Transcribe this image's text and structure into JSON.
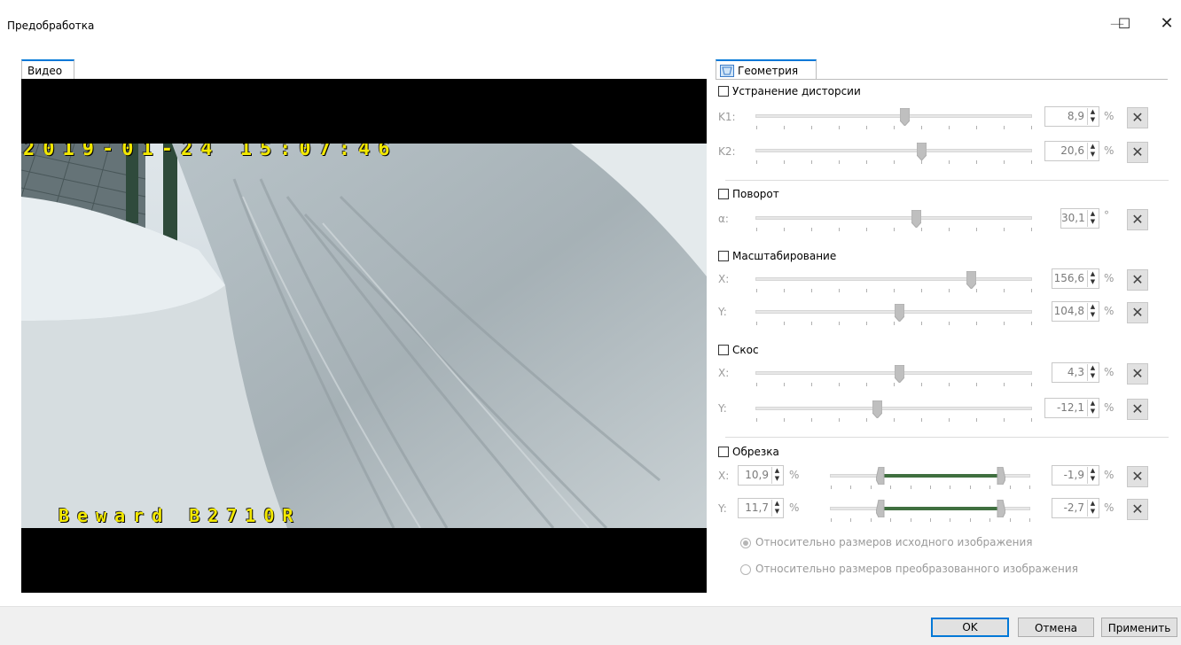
{
  "window": {
    "title": "Предобработка",
    "minimize": "—",
    "maximize": "☐",
    "close": "✕"
  },
  "video_tab": {
    "label": "Видео"
  },
  "video": {
    "timestamp": "2019-01-24 15:07:46",
    "camera": "Beward B2710R"
  },
  "geometry_tab": {
    "label": "Геометрия",
    "icon": "geometry-icon"
  },
  "distortion": {
    "label": "Устранение дисторсии",
    "checked": false,
    "k1": {
      "label": "K1:",
      "value": "8,9",
      "unit": "%",
      "position": 0.54
    },
    "k2": {
      "label": "K2:",
      "value": "20,6",
      "unit": "%",
      "position": 0.6
    }
  },
  "rotation": {
    "label": "Поворот",
    "checked": false,
    "alpha": {
      "label": "α:",
      "value": "30,1",
      "unit": "°",
      "position": 0.58
    }
  },
  "scaling": {
    "label": "Масштабирование",
    "checked": false,
    "x": {
      "label": "X:",
      "value": "156,6",
      "unit": "%",
      "position": 0.78
    },
    "y": {
      "label": "Y:",
      "value": "104,8",
      "unit": "%",
      "position": 0.52
    }
  },
  "skew": {
    "label": "Скос",
    "checked": false,
    "x": {
      "label": "X:",
      "value": "4,3",
      "unit": "%",
      "position": 0.52
    },
    "y": {
      "label": "Y:",
      "value": "-12,1",
      "unit": "%",
      "position": 0.44
    }
  },
  "crop": {
    "label": "Обрезка",
    "checked": false,
    "x": {
      "label": "X:",
      "left_value": "10,9",
      "right_value": "-1,9",
      "unit": "%",
      "range": [
        0.25,
        0.85
      ]
    },
    "y": {
      "label": "Y:",
      "left_value": "11,7",
      "right_value": "-2,7",
      "unit": "%",
      "range": [
        0.25,
        0.85
      ]
    },
    "options": [
      {
        "label": "Относительно размеров исходного изображения",
        "selected": true
      },
      {
        "label": "Относительно размеров преобразованного изображения",
        "selected": false
      }
    ]
  },
  "footer": {
    "ok": "OK",
    "cancel": "Отмена",
    "apply": "Применить"
  },
  "colors": {
    "accent": "#0078d7",
    "osd": "#f2e800",
    "crop_range": "#3f6f3f",
    "disabled": "#9a9a9a"
  }
}
